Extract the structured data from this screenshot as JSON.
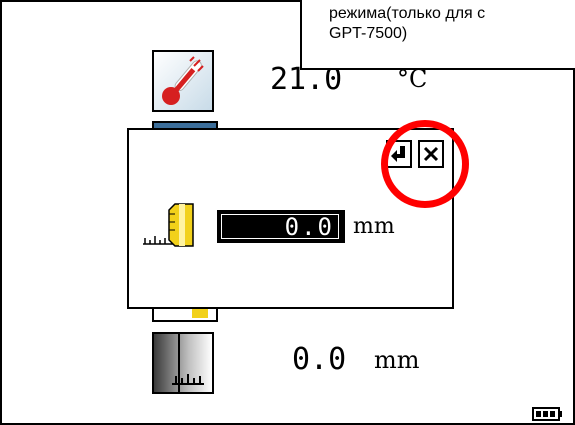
{
  "callout": {
    "line1": "режима(только для с",
    "line2": "GPT-7500)"
  },
  "temperature": {
    "value": "21.0",
    "unit": "°C",
    "icon": "thermometer-icon"
  },
  "distance_row": {
    "value": "0.0",
    "unit": "mm",
    "icon": "ruler-icon"
  },
  "dialog": {
    "value": "0.0",
    "unit": "mm",
    "enter_icon": "enter-icon",
    "close_icon": "close-icon",
    "ruler_icon": "ruler-icon"
  },
  "status": {
    "battery_icon": "battery-icon"
  },
  "colors": {
    "highlight": "#ff0000",
    "ruler_yellow": "#f2d11a",
    "thermo_red": "#d62020"
  }
}
